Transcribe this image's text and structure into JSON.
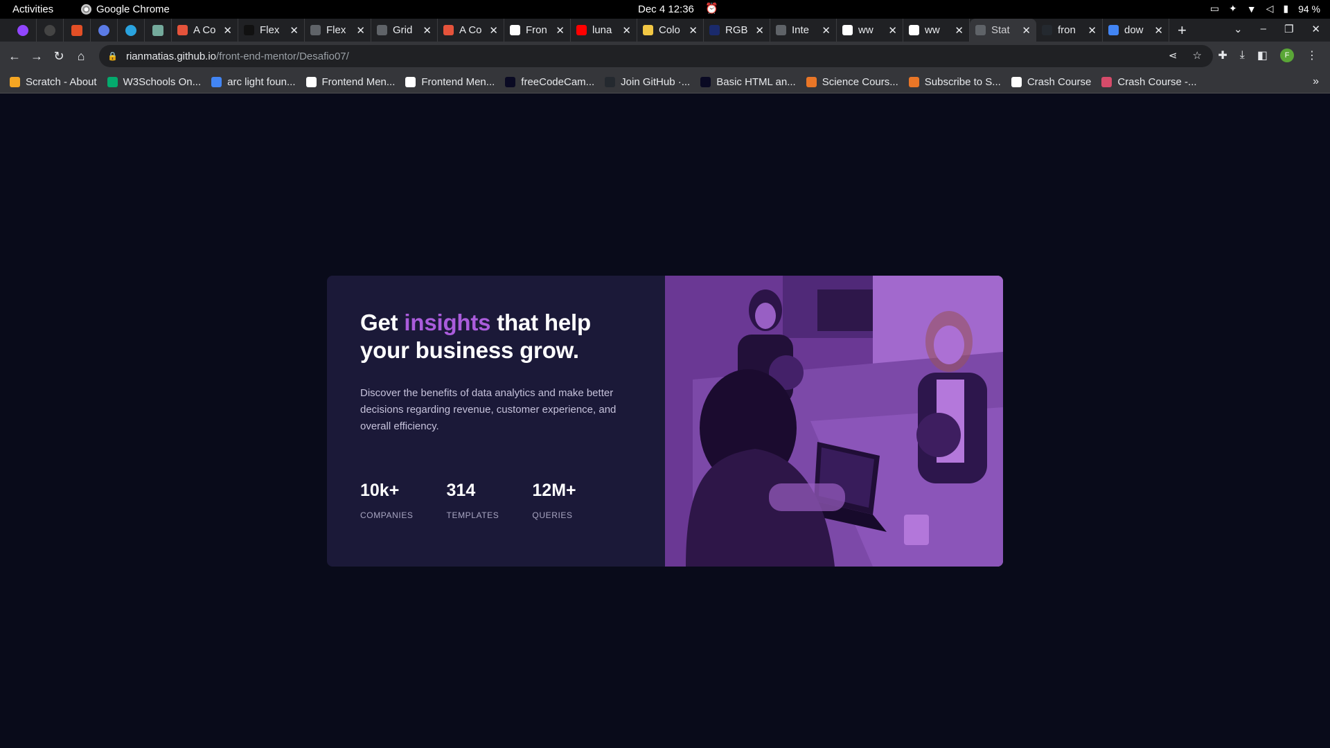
{
  "os": {
    "activities": "Activities",
    "app_name": "Google Chrome",
    "clock": "Dec 4  12:36",
    "battery": "94 %"
  },
  "browser": {
    "tabs": [
      {
        "title": "A Co",
        "color": "#e5533b"
      },
      {
        "title": "Flex",
        "color": "#111111"
      },
      {
        "title": "Flex",
        "color": "#5f6368"
      },
      {
        "title": "Grid",
        "color": "#5f6368"
      },
      {
        "title": "A Co",
        "color": "#e5533b"
      },
      {
        "title": "Fron",
        "color": "#ffffff"
      },
      {
        "title": "luna",
        "color": "#ff0000"
      },
      {
        "title": "Colo",
        "color": "#f2c744"
      },
      {
        "title": "RGB",
        "color": "#1a2a6c"
      },
      {
        "title": "Inte",
        "color": "#5f6368"
      },
      {
        "title": "ww",
        "color": "#ffffff"
      },
      {
        "title": "ww",
        "color": "#ffffff"
      },
      {
        "title": "Stat",
        "color": "#5f6368",
        "active": true
      },
      {
        "title": "fron",
        "color": "#24292f"
      },
      {
        "title": "dow",
        "color": "#4285f4"
      }
    ],
    "url_host": "rianmatias.github.io",
    "url_path": "/front-end-mentor/Desafio07/",
    "profile_initial": "F",
    "bookmarks": [
      {
        "label": "Scratch - About",
        "color": "#f5a623"
      },
      {
        "label": "W3Schools On...",
        "color": "#04aa6d"
      },
      {
        "label": "arc light foun...",
        "color": "#4285f4"
      },
      {
        "label": "Frontend Men...",
        "color": "#ffffff"
      },
      {
        "label": "Frontend Men...",
        "color": "#ffffff"
      },
      {
        "label": "freeCodeCam...",
        "color": "#0a0a23"
      },
      {
        "label": "Join GitHub ·...",
        "color": "#24292f"
      },
      {
        "label": "Basic HTML an...",
        "color": "#0a0a23"
      },
      {
        "label": "Science Cours...",
        "color": "#e97627"
      },
      {
        "label": "Subscribe to S...",
        "color": "#e97627"
      },
      {
        "label": "Crash Course",
        "color": "#ffffff"
      },
      {
        "label": "Crash Course -...",
        "color": "#d64b6a"
      }
    ]
  },
  "card": {
    "headline_before": "Get ",
    "headline_accent": "insights",
    "headline_after": " that help your business grow.",
    "description": "Discover the benefits of data analytics and make better decisions regarding revenue, customer experience, and overall efficiency.",
    "stats": [
      {
        "value": "10k+",
        "label": "Companies"
      },
      {
        "value": "314",
        "label": "Templates"
      },
      {
        "value": "12M+",
        "label": "Queries"
      }
    ],
    "colors": {
      "page_bg": "#090b1a",
      "card_bg": "#1b1938",
      "accent": "#aa5cdb",
      "text": "#ffffff",
      "muted": "#c6c2db"
    }
  }
}
